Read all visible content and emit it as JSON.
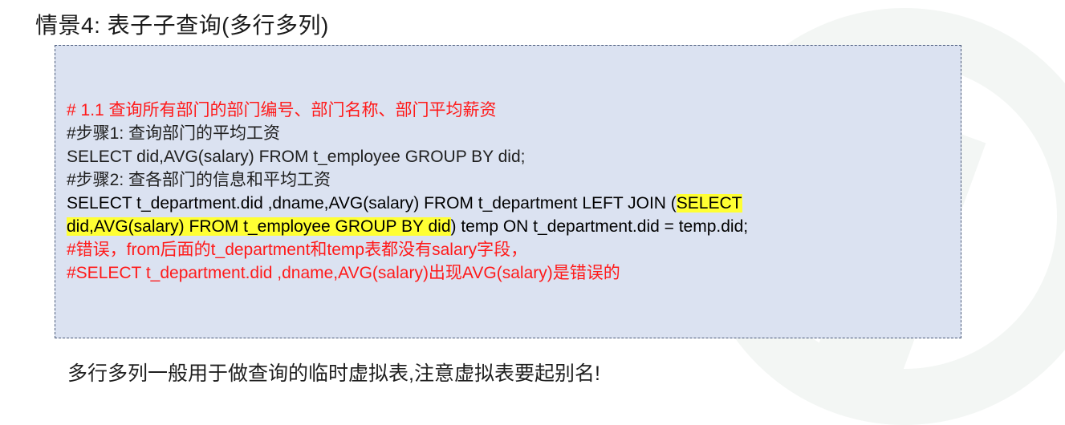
{
  "title": "情景4: 表子子查询(多行多列)",
  "code": {
    "comment_1": "# 1.1 查询所有部门的部门编号、部门名称、部门平均薪资",
    "step_1": "#步骤1: 查询部门的平均工资",
    "sql_1": "SELECT did,AVG(salary) FROM t_employee GROUP BY did;",
    "step_2": "#步骤2: 查各部门的信息和平均工资",
    "sql_2_part_a": "SELECT t_department.did ,dname,AVG(salary) FROM t_department LEFT JOIN (",
    "sql_2_highlight_a": "SELECT",
    "sql_2_highlight_b": "did,AVG(salary) FROM t_employee GROUP BY did",
    "sql_2_part_b": ") temp ON t_department.did = temp.did;",
    "error_1": "#错误，from后面的t_department和temp表都没有salary字段，",
    "error_2": "#SELECT t_department.did ,dname,AVG(salary)出现AVG(salary)是错误的"
  },
  "note": "多行多列一般用于做查询的临时虚拟表,注意虚拟表要起别名!",
  "colors": {
    "box_background": "#dbe2f1",
    "comment_red": "#ff1a1a",
    "highlight_yellow": "#ffff33"
  }
}
